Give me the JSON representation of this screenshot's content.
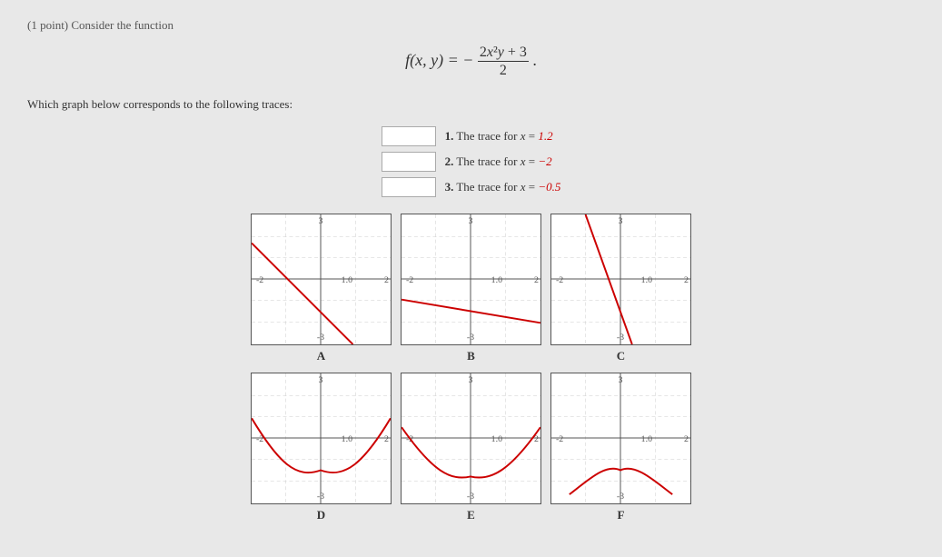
{
  "header": {
    "point_label": "(1 point) Consider the function"
  },
  "function": {
    "display": "f(x, y) = −(2x²y + 3) / 2",
    "fx": "f(x, y) =",
    "numerator": "2x²y + 3",
    "denominator": "2"
  },
  "question": {
    "text": "Which graph below corresponds to the following traces:"
  },
  "traces": [
    {
      "number": "1.",
      "text": "The trace for ",
      "math": "x = 1.2"
    },
    {
      "number": "2.",
      "text": "The trace for ",
      "math": "x = −2"
    },
    {
      "number": "3.",
      "text": "The trace for ",
      "math": "x = −0.5"
    }
  ],
  "graphs": {
    "top_row": [
      {
        "id": "A",
        "label": "A"
      },
      {
        "id": "B",
        "label": "B"
      },
      {
        "id": "C",
        "label": "C"
      }
    ],
    "bottom_row": [
      {
        "id": "D",
        "label": "D"
      },
      {
        "id": "E",
        "label": "E"
      },
      {
        "id": "F",
        "label": "F"
      }
    ]
  },
  "axes": {
    "x_min": -2,
    "x_max": 2,
    "y_min": -3,
    "y_max": 3
  }
}
